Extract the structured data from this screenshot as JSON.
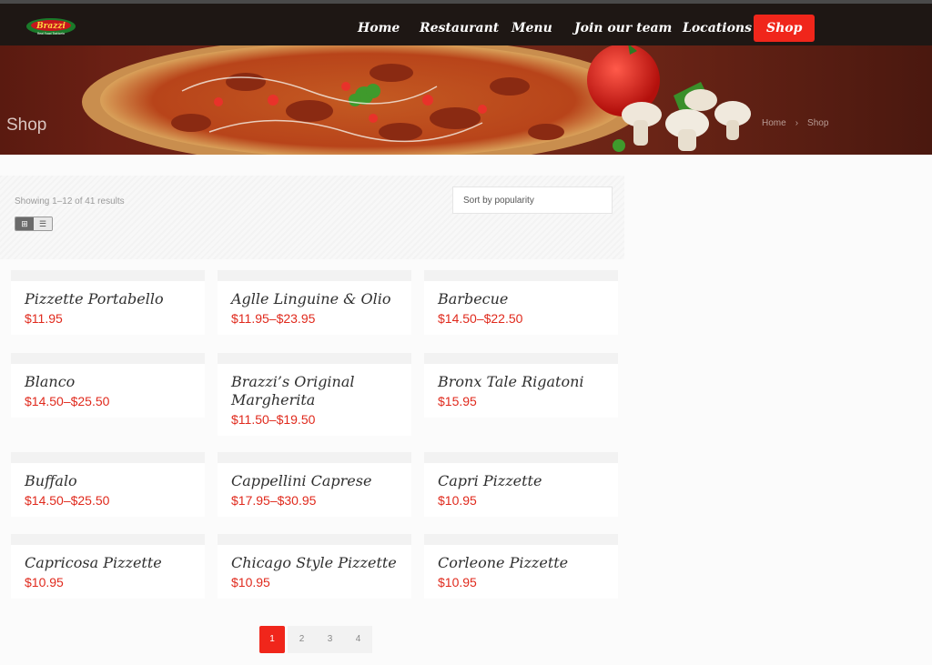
{
  "brand": {
    "logo_text": "Brazzi",
    "logo_tagline": "Real Food Trattoria"
  },
  "nav": {
    "items": [
      "Home",
      "Restaurant",
      "Menu",
      "Join our team",
      "Locations"
    ],
    "shop": "Shop"
  },
  "hero": {
    "title": "Shop",
    "breadcrumb": [
      "Home",
      "Shop"
    ],
    "separator": "›"
  },
  "toolbar": {
    "results": "Showing 1–12 of 41 results",
    "sort": "Sort by popularity",
    "grid_icon": "⊞",
    "list_icon": "☰"
  },
  "products": [
    {
      "name": "Pizzette Portabello",
      "price": "$11.95"
    },
    {
      "name": "Aglle Linguine & Olio",
      "price": "$11.95–$23.95"
    },
    {
      "name": "Barbecue",
      "price": "$14.50–$22.50"
    },
    {
      "name": "Blanco",
      "price": "$14.50–$25.50"
    },
    {
      "name": "Brazzi’s Original Margherita",
      "price": "$11.50–$19.50"
    },
    {
      "name": "Bronx Tale Rigatoni",
      "price": "$15.95"
    },
    {
      "name": "Buffalo",
      "price": "$14.50–$25.50"
    },
    {
      "name": "Cappellini Caprese",
      "price": "$17.95–$30.95"
    },
    {
      "name": "Capri Pizzette",
      "price": "$10.95"
    },
    {
      "name": "Capricosa Pizzette",
      "price": "$10.95"
    },
    {
      "name": "Chicago Style Pizzette",
      "price": "$10.95"
    },
    {
      "name": "Corleone Pizzette",
      "price": "$10.95"
    }
  ],
  "pagination": [
    "1",
    "2",
    "3",
    "4"
  ],
  "colors": {
    "accent": "#f0261b",
    "price": "#e02a1d",
    "nav_bg": "#1e1714"
  }
}
